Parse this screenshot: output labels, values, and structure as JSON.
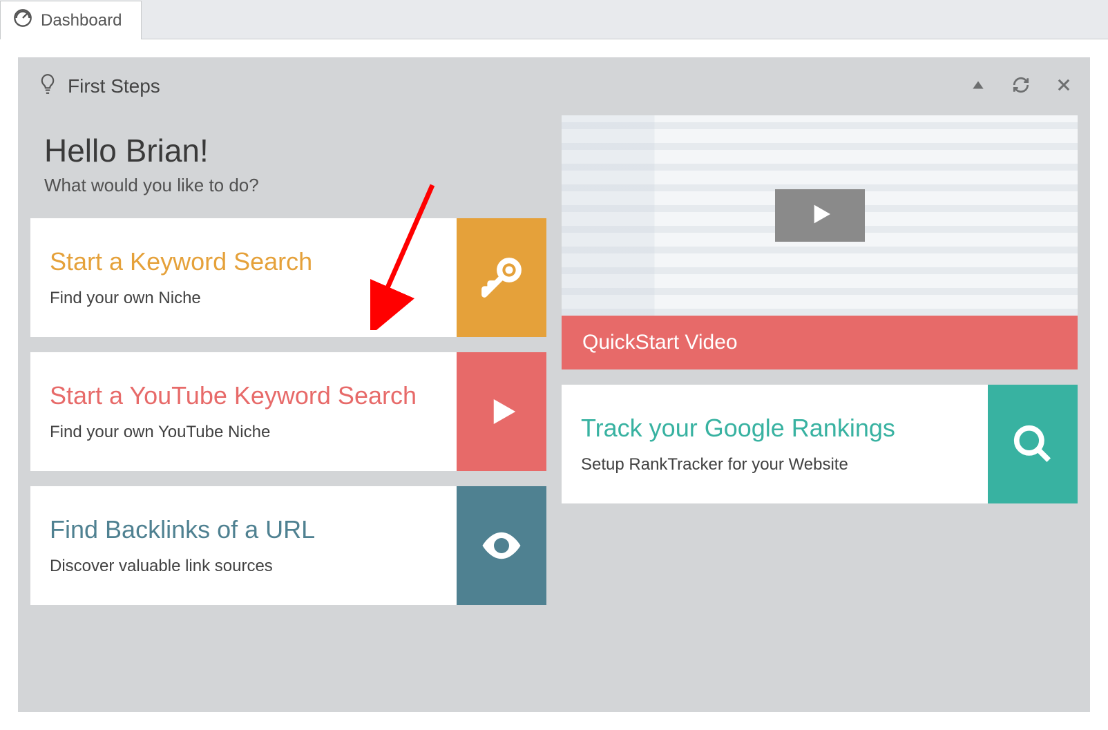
{
  "tab": {
    "label": "Dashboard"
  },
  "panel": {
    "title": "First Steps"
  },
  "greeting": {
    "headline": "Hello Brian!",
    "sub": "What would you like to do?"
  },
  "cards": {
    "keyword": {
      "title": "Start a Keyword Search",
      "sub": "Find your own Niche"
    },
    "youtube": {
      "title": "Start a YouTube Keyword Search",
      "sub": "Find your own YouTube Niche"
    },
    "backlinks": {
      "title": "Find Backlinks of a URL",
      "sub": "Discover valuable link sources"
    },
    "rank": {
      "title": "Track your Google Rankings",
      "sub": "Setup RankTracker for your Website"
    }
  },
  "video": {
    "label": "QuickStart Video"
  },
  "colors": {
    "orange": "#e5a13a",
    "red": "#e76a69",
    "slate": "#4f8191",
    "teal": "#38b2a1"
  }
}
